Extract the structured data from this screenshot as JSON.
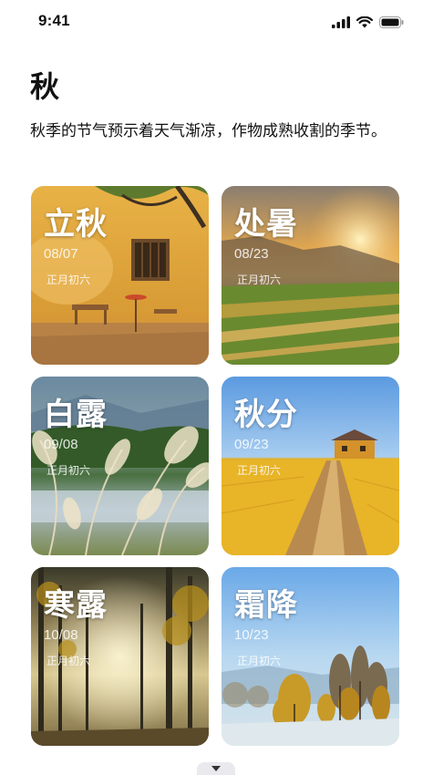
{
  "status_bar": {
    "time": "9:41"
  },
  "header": {
    "title": "秋",
    "description": "秋季的节气预示着天气渐凉，作物成熟收割的季节。"
  },
  "cards": [
    {
      "name": "立秋",
      "date": "08/07",
      "lunar": "正月初六"
    },
    {
      "name": "处暑",
      "date": "08/23",
      "lunar": "正月初六"
    },
    {
      "name": "白露",
      "date": "09/08",
      "lunar": "正月初六"
    },
    {
      "name": "秋分",
      "date": "09/23",
      "lunar": "正月初六"
    },
    {
      "name": "寒露",
      "date": "10/08",
      "lunar": "正月初六"
    },
    {
      "name": "霜降",
      "date": "10/23",
      "lunar": "正月初六"
    }
  ],
  "icons": {
    "signal": "signal-icon",
    "wifi": "wifi-icon",
    "battery": "battery-icon",
    "handle": "chevron-down-icon"
  }
}
